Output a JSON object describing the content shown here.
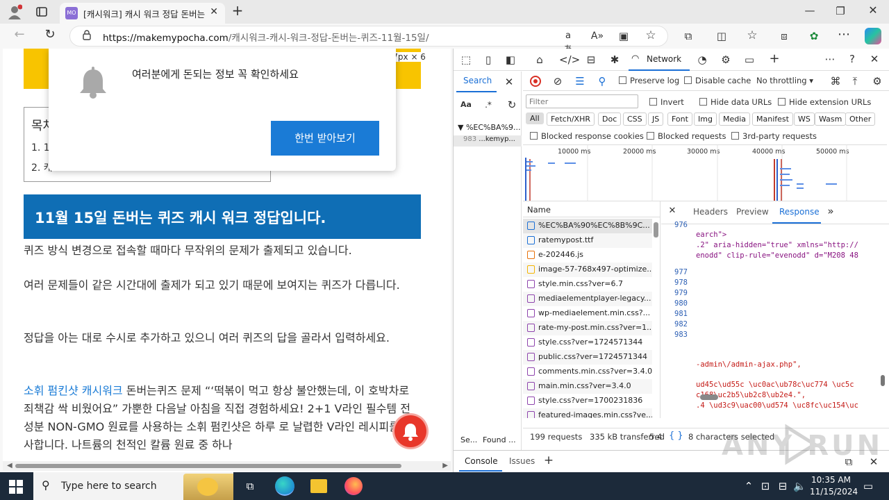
{
  "browser": {
    "tab_title": "[캐시워크] 캐시 워크 정답 돈버는",
    "tab_favicon": "MO",
    "url_domain": "https://makemypocha.com",
    "url_path": "/캐시워크-캐시-워크-정답-돈버는-퀴즈-11월-15일/"
  },
  "page": {
    "size_badge": "647px × 6",
    "notif_text": "여러분에게 돈되는 정보 꼭 확인하세요",
    "notif_button": "한번 받아보기",
    "toc_title": "목차",
    "toc_item_1": "1. 11",
    "toc_item_2": "2. 캐",
    "heading": "11월 15일 돈버는 퀴즈 캐시 워크 정답입니다.",
    "para1": "퀴즈 방식 변경으로 접속할 때마다 무작위의 문제가 출제되고 있습니다.",
    "para2": "여러 문제들이 같은 시간대에 출제가 되고 있기 때문에 보여지는 퀴즈가 다릅니다.",
    "para3": "정답을 아는 대로 수시로 추가하고 있으니 여러 퀴즈의 답을 골라서 입력하세요.",
    "para4_link": "소휘 펌킨샷 캐시워크",
    "para4_rest": " 돈버는퀴즈 문제 “‘떡볶이 먹고 항상 불안했는데, 이 호박차로 죄책감 싹 비웠어요” 가뿐한 다음날 아침을 직접 경험하세요! 2+1 V라인 필수템 전성분 NON-GMO 원료를 사용하는 소휘 펌킨샷은 하루 로 날렵한 V라인 레시피를 선사합니다. 나트륨의 천적인 칼륨 원료 중 하나"
  },
  "devtools": {
    "top_tabs": [
      "Network"
    ],
    "search_tab": "Search",
    "search_tree_item": "%EC%BA%9...",
    "search_result_line": "983",
    "search_result_text": "...kemyp...",
    "search_footer_left": "Se...",
    "search_footer_right": "Found ...",
    "preserve_log": "Preserve log",
    "disable_cache": "Disable cache",
    "throttling": "No throttling",
    "filter_placeholder": "Filter",
    "invert": "Invert",
    "hide_data_urls": "Hide data URLs",
    "hide_ext_urls": "Hide extension URLs",
    "type_filters": [
      "All",
      "Fetch/XHR",
      "Doc",
      "CSS",
      "JS",
      "Font",
      "Img",
      "Media",
      "Manifest",
      "WS",
      "Wasm",
      "Other"
    ],
    "blocked_cookies": "Blocked response cookies",
    "blocked_requests": "Blocked requests",
    "third_party": "3rd-party requests",
    "timeline_ticks": [
      "10000 ms",
      "20000 ms",
      "30000 ms",
      "40000 ms",
      "50000 ms"
    ],
    "name_header": "Name",
    "requests": [
      "%EC%BA%90%EC%8B%9C...",
      "ratemypost.ttf",
      "e-202446.js",
      "image-57-768x497-optimize...",
      "style.min.css?ver=6.7",
      "mediaelementplayer-legacy...",
      "wp-mediaelement.min.css?...",
      "rate-my-post.min.css?ver=1...",
      "style.css?ver=1724571344",
      "public.css?ver=1724571344",
      "comments.min.css?ver=3.4.0",
      "main.min.css?ver=3.4.0",
      "style.css?ver=1700231836",
      "featured-images.min.css?ve..."
    ],
    "detail_tabs": [
      "Headers",
      "Preview",
      "Response"
    ],
    "line_numbers": [
      "976",
      "977",
      "978",
      "979",
      "980",
      "981",
      "982",
      "983"
    ],
    "code_lines": [
      "earch\">",
      ".2\" aria-hidden=\"true\" xmlns=\"http://",
      "enodd\" clip-rule=\"evenodd\" d=\"M208 48",
      "-admin\\/admin-ajax.php\",",
      "ud45c\\ud55c \\uc0ac\\ub78c\\uc774 \\uc5c",
      "c168\\uc2b5\\ub2c8\\ub2e4.\",",
      ".4 \\ud3c9\\uac00\\ud574 \\uc8fc\\uc154\\uc"
    ],
    "status_requests": "199 requests",
    "status_transferred": "335 kB transferred",
    "status_extra": "5.4",
    "selected_chars": "8 characters selected",
    "drawer_tabs": [
      "Console",
      "Issues"
    ]
  },
  "taskbar": {
    "search_placeholder": "Type here to search",
    "time": "10:35 AM",
    "date": "11/15/2024"
  },
  "watermark": "ANY RUN"
}
